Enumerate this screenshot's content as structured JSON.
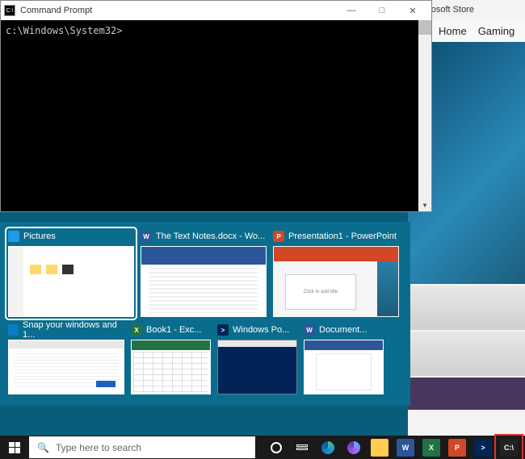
{
  "cmd_window": {
    "title": "Command Prompt",
    "prompt": "c:\\Windows\\System32>"
  },
  "store_window": {
    "title": "Microsoft Store",
    "nav": {
      "home": "Home",
      "gaming": "Gaming"
    }
  },
  "snap_tiles": {
    "row1": [
      {
        "label": "Pictures",
        "icon_letter": ""
      },
      {
        "label": "The Text Notes.docx - Wo...",
        "icon_letter": "W"
      },
      {
        "label": "Presentation1 - PowerPoint",
        "icon_letter": "P"
      }
    ],
    "row2": [
      {
        "label": "Snap your windows and 1...",
        "icon_letter": ""
      },
      {
        "label": "Book1 - Exc...",
        "icon_letter": "X"
      },
      {
        "label": "Windows Po...",
        "icon_letter": ">"
      },
      {
        "label": "Document...",
        "icon_letter": "W"
      }
    ]
  },
  "ppt_thumb_text": "Click to add title",
  "taskbar": {
    "search_placeholder": "Type here to search"
  }
}
